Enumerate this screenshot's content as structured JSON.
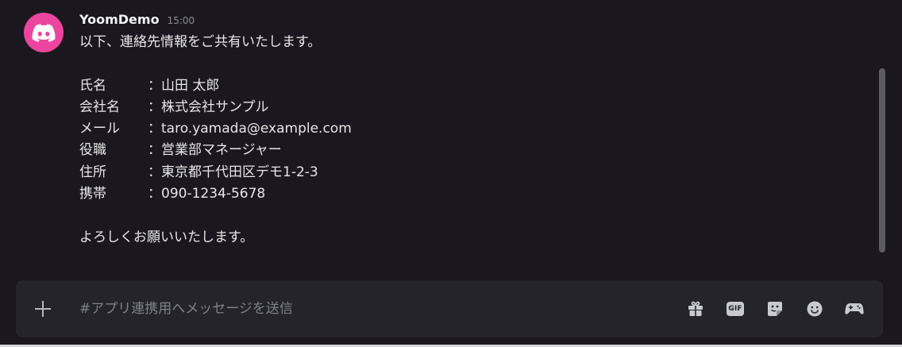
{
  "message": {
    "author": "YoomDemo",
    "timestamp": "15:00",
    "intro": "以下、連絡先情報をご共有いたします。",
    "fields": [
      {
        "label": "氏名",
        "value": "：山田 太郎"
      },
      {
        "label": "会社名",
        "value": "：株式会社サンプル"
      },
      {
        "label": "メール",
        "value": "：taro.yamada@example.com"
      },
      {
        "label": "役職",
        "value": "：営業部マネージャー"
      },
      {
        "label": "住所",
        "value": "：東京都千代田区デモ1-2-3"
      },
      {
        "label": "携帯",
        "value": "：090-1234-5678"
      }
    ],
    "closing": "よろしくお願いいたします。"
  },
  "avatar": {
    "icon": "discord-logo-icon",
    "color": "#eb459f"
  },
  "composer": {
    "placeholder": "#アプリ連携用へメッセージを送信",
    "value": "",
    "gif_label": "GIF",
    "icons": [
      "plus-icon",
      "gift-icon",
      "gif-icon",
      "sticker-icon",
      "emoji-icon",
      "game-controller-icon"
    ]
  },
  "colors": {
    "background": "#1a181e",
    "composer": "#25242b",
    "text": "#f2f3f5",
    "muted": "#8a8d93",
    "accent": "#eb459f"
  }
}
